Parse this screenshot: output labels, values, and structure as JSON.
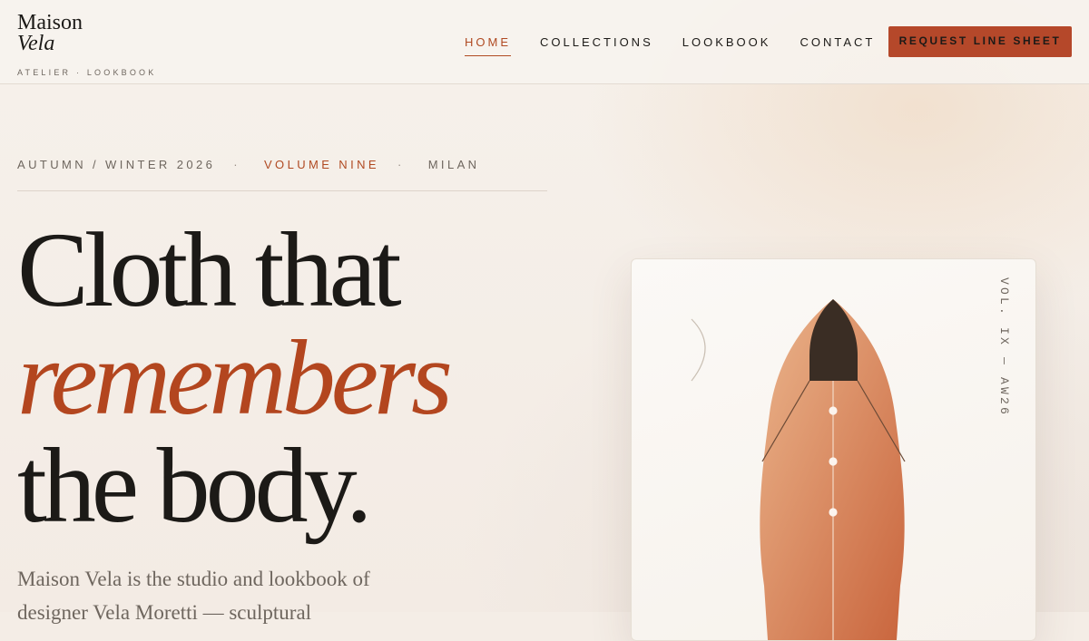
{
  "brand": {
    "name_line1": "Maison",
    "name_line2": "Vela",
    "tagline": "ATELIER · LOOKBOOK"
  },
  "nav": {
    "items": [
      {
        "label": "HOME",
        "active": true
      },
      {
        "label": "COLLECTIONS",
        "active": false
      },
      {
        "label": "LOOKBOOK",
        "active": false
      },
      {
        "label": "CONTACT",
        "active": false
      }
    ],
    "cta_label": "REQUEST LINE SHEET"
  },
  "hero": {
    "meta": {
      "season": "AUTUMN / WINTER 2026",
      "separator": "·",
      "volume": "VOLUME NINE",
      "city": "MILAN"
    },
    "headline": {
      "line1": "Cloth that",
      "line2": "remembers",
      "line3": "the body."
    },
    "intro": "Maison Vela is the studio and lookbook of designer Vela Moretti — sculptural"
  },
  "card": {
    "vertical_label": "VOL. IX — AW26",
    "illustration": "garment-dress-icon"
  },
  "colors": {
    "accent": "#b3461f",
    "cta_bg": "#b5482a",
    "ink": "#1c1a17",
    "muted": "#6e665e",
    "garment_light": "#e8b088",
    "garment_dark": "#c9683f",
    "collar": "#3a2d24"
  }
}
